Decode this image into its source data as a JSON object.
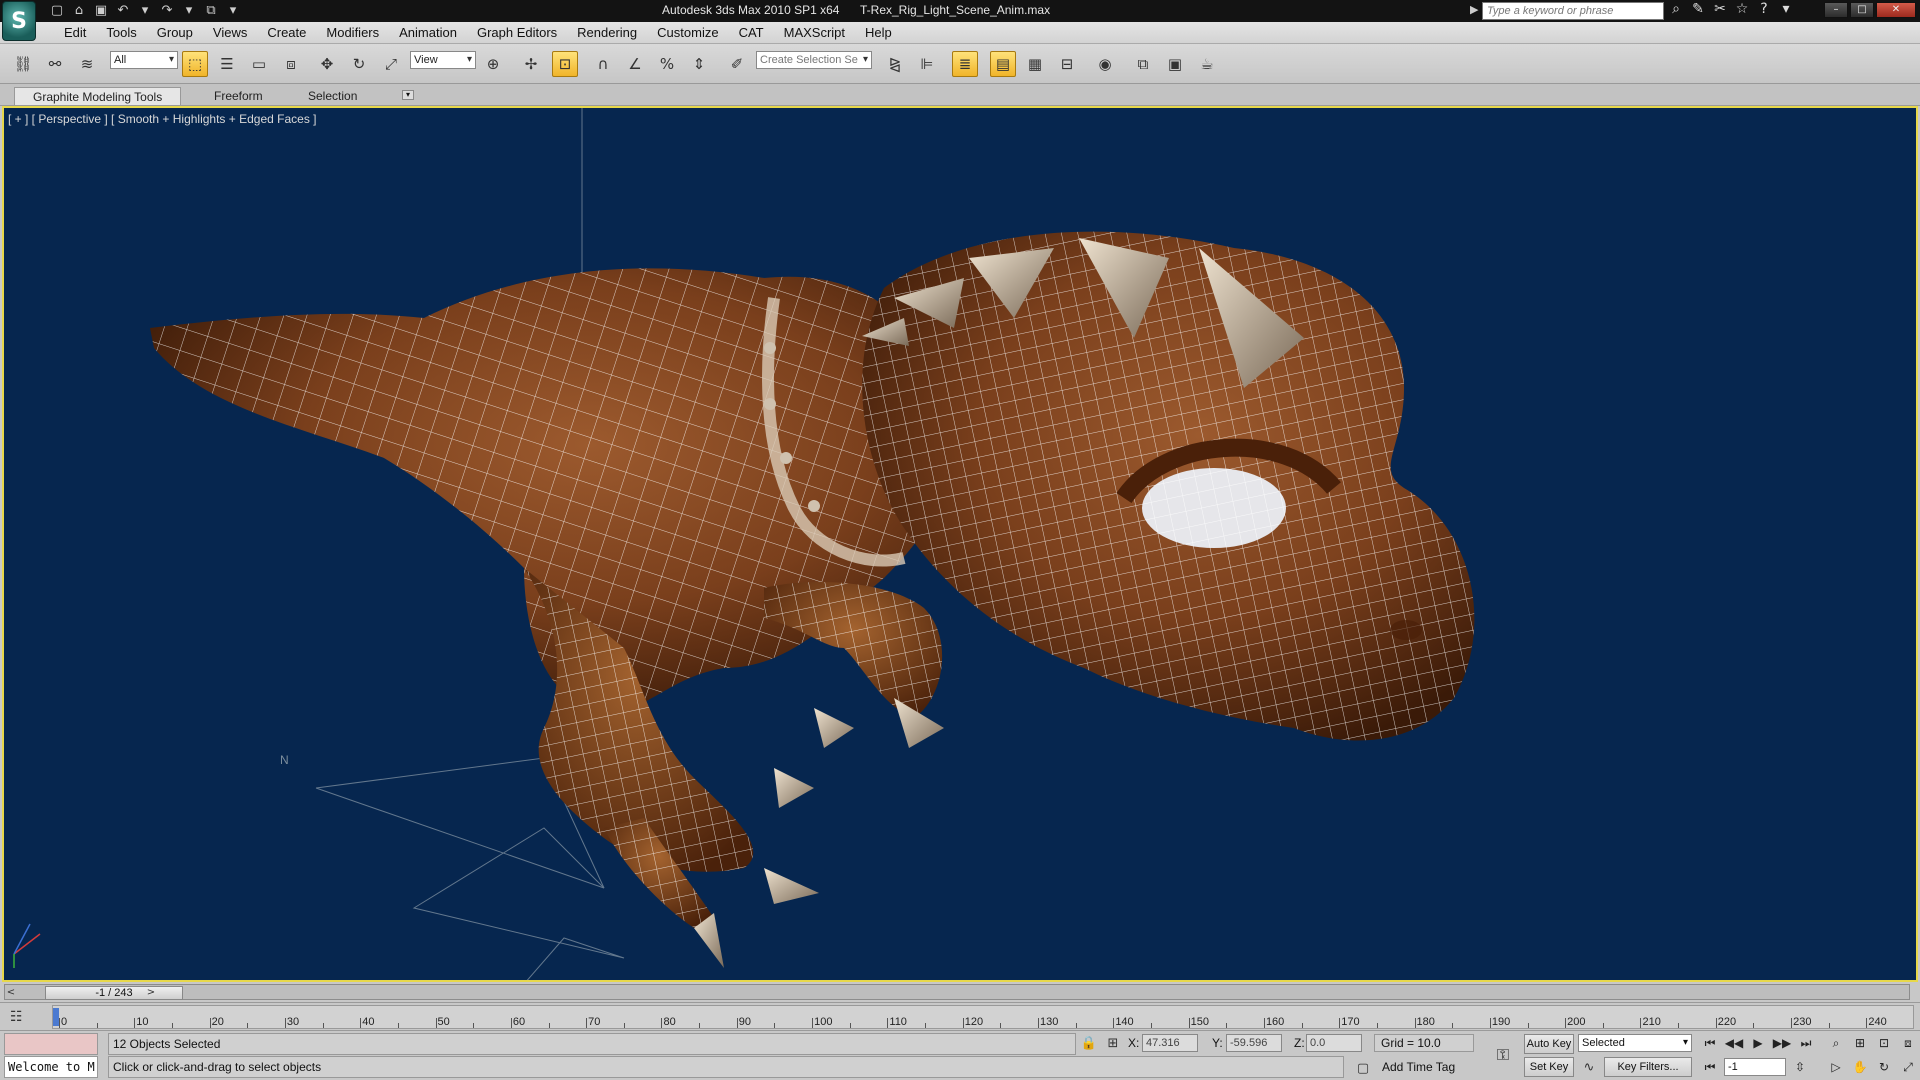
{
  "titlebar": {
    "app_title": "Autodesk 3ds Max  2010 SP1 x64",
    "file_name": "T-Rex_Rig_Light_Scene_Anim.max",
    "search_placeholder": "Type a keyword or phrase",
    "logo_glyph": "S"
  },
  "menu": {
    "items": [
      "Edit",
      "Tools",
      "Group",
      "Views",
      "Create",
      "Modifiers",
      "Animation",
      "Graph Editors",
      "Rendering",
      "Customize",
      "CAT",
      "MAXScript",
      "Help"
    ]
  },
  "toolbar": {
    "selection_filter": "All",
    "reference_coord": "View",
    "named_selection_placeholder": "Create Selection Se"
  },
  "ribbon": {
    "tabs": [
      "Graphite Modeling Tools",
      "Freeform",
      "Selection"
    ]
  },
  "viewport": {
    "label": "[ + ] [ Perspective ] [ Smooth + Highlights + Edged Faces ]",
    "compass_label": "N",
    "background": "#06264f",
    "border_color": "#e7d84a"
  },
  "timeline": {
    "frame_display": "-1 / 243",
    "ticks": [
      "0",
      "10",
      "20",
      "30",
      "40",
      "50",
      "60",
      "70",
      "80",
      "90",
      "100",
      "110",
      "120",
      "130",
      "140",
      "150",
      "160",
      "170",
      "180",
      "190",
      "200",
      "210",
      "220",
      "230",
      "240"
    ]
  },
  "status": {
    "maxscript_text": "Welcome to M",
    "selection_text": "12 Objects Selected",
    "prompt_text": "Click or click-and-drag to select objects",
    "x_label": "X:",
    "x_value": "47.316",
    "y_label": "Y:",
    "y_value": "-59.596",
    "z_label": "Z:",
    "z_value": "0.0",
    "grid_text": "Grid = 10.0",
    "add_time_tag": "Add Time Tag",
    "auto_key": "Auto Key",
    "set_key": "Set Key",
    "key_mode": "Selected",
    "key_filters": "Key Filters...",
    "current_frame": "-1"
  }
}
